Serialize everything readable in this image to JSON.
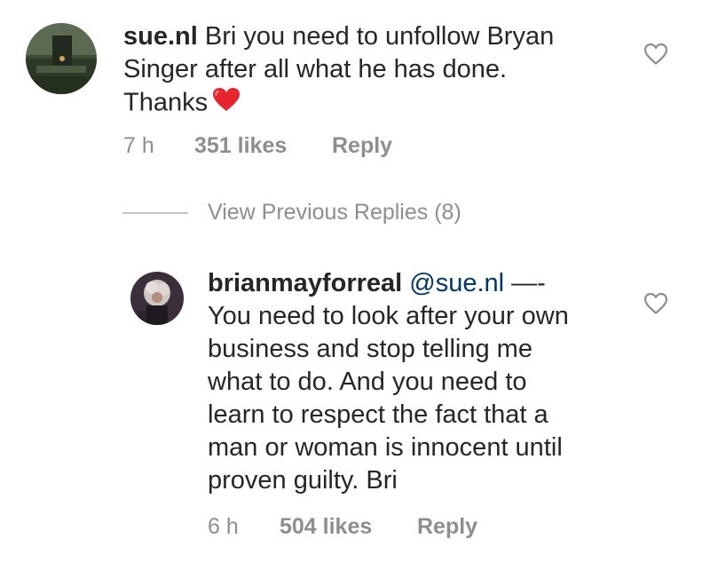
{
  "comment1": {
    "username": "sue.nl",
    "text": "Bri you need to unfollow Bryan Singer after all what he has done. Thanks",
    "line1": "Bri you need to unfollow Bryan",
    "line2": "Singer after all what he has done.",
    "line3": "Thanks",
    "emoji": "red-heart",
    "time": "7 h",
    "likes": "351 likes",
    "reply": "Reply",
    "like_icon": "heart-outline-icon"
  },
  "view_previous": {
    "label": "View Previous Replies (8)"
  },
  "comment2": {
    "username": "brianmayforreal",
    "mention": "@sue.nl",
    "dash": "—-",
    "lines": [
      "You need to look after your own",
      "business and stop telling me",
      "what to do. And you need to",
      "learn to respect the fact that a",
      "man or woman is innocent until",
      "proven guilty. Bri"
    ],
    "time": "6 h",
    "likes": "504 likes",
    "reply": "Reply",
    "like_icon": "heart-outline-icon"
  },
  "colors": {
    "text": "#262626",
    "secondary": "#8e8e8e",
    "mention": "#00376b",
    "emoji_heart": "#e8242f"
  }
}
